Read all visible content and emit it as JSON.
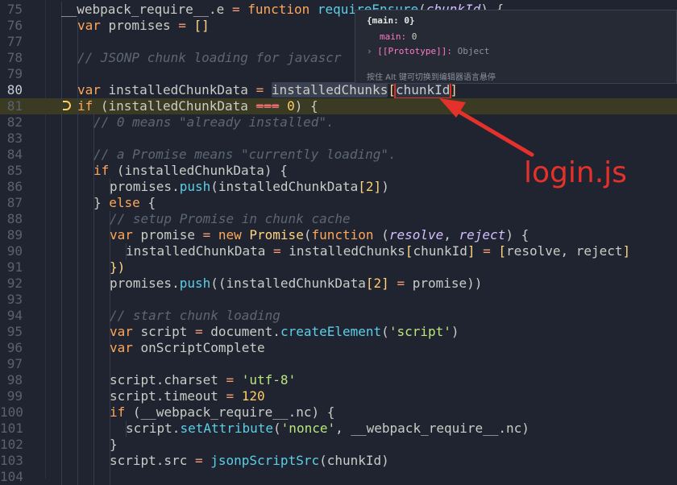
{
  "editor": {
    "lines": [
      {
        "n": "75",
        "indent": 1,
        "tokens": [
          [
            "__webpack_require__",
            "v"
          ],
          [
            ".e ",
            "v"
          ],
          [
            "= ",
            "p"
          ],
          [
            "function ",
            "k"
          ],
          [
            "requireEnsure",
            "f"
          ],
          [
            "(",
            "v"
          ],
          [
            "chunkId",
            "it"
          ],
          [
            ") {",
            "v"
          ]
        ]
      },
      {
        "n": "76",
        "indent": 2,
        "tokens": [
          [
            "var ",
            "k"
          ],
          [
            "promises ",
            "v"
          ],
          [
            "= ",
            "p"
          ],
          [
            "[]",
            "y"
          ]
        ]
      },
      {
        "n": "77",
        "indent": 2,
        "tokens": []
      },
      {
        "n": "78",
        "indent": 2,
        "tokens": [
          [
            "// JSONP chunk loading for javascr",
            "c"
          ]
        ]
      },
      {
        "n": "79",
        "indent": 2,
        "tokens": []
      },
      {
        "n": "80",
        "indent": 2,
        "current": true,
        "tokens": [
          [
            "var ",
            "k"
          ],
          [
            "installedChunkData ",
            "v"
          ],
          [
            "= ",
            "p"
          ],
          [
            "installedChunks",
            "hl"
          ],
          [
            "[",
            "y"
          ],
          [
            "chunkId",
            "box"
          ],
          [
            "]",
            "y"
          ]
        ]
      },
      {
        "n": "81",
        "indent": 2,
        "exec": true,
        "tokens": [
          [
            "if ",
            "k"
          ],
          [
            "(installedChunkData ",
            "v"
          ],
          [
            "===",
            "neq"
          ],
          [
            " 0",
            "n"
          ],
          [
            ") {",
            "v"
          ]
        ]
      },
      {
        "n": "82",
        "indent": 3,
        "tokens": [
          [
            "// 0 means \"already installed\".",
            "c"
          ]
        ]
      },
      {
        "n": "83",
        "indent": 3,
        "tokens": []
      },
      {
        "n": "84",
        "indent": 3,
        "tokens": [
          [
            "// a Promise means \"currently loading\".",
            "c"
          ]
        ]
      },
      {
        "n": "85",
        "indent": 3,
        "tokens": [
          [
            "if ",
            "k"
          ],
          [
            "(installedChunkData) {",
            "v"
          ]
        ]
      },
      {
        "n": "86",
        "indent": 4,
        "tokens": [
          [
            "promises",
            "v"
          ],
          [
            ".",
            "v"
          ],
          [
            "push",
            "f"
          ],
          [
            "(installedChunkData",
            "v"
          ],
          [
            "[",
            "y"
          ],
          [
            "2",
            "n"
          ],
          [
            "]",
            "y"
          ],
          [
            ")",
            "v"
          ]
        ]
      },
      {
        "n": "87",
        "indent": 3,
        "tokens": [
          [
            "} ",
            "v"
          ],
          [
            "else ",
            "k"
          ],
          [
            "{",
            "v"
          ]
        ]
      },
      {
        "n": "88",
        "indent": 4,
        "tokens": [
          [
            "// setup Promise in chunk cache",
            "c"
          ]
        ]
      },
      {
        "n": "89",
        "indent": 4,
        "tokens": [
          [
            "var ",
            "k"
          ],
          [
            "promise ",
            "v"
          ],
          [
            "= ",
            "p"
          ],
          [
            "new ",
            "k"
          ],
          [
            "Promise",
            "y"
          ],
          [
            "(",
            "v"
          ],
          [
            "function ",
            "k"
          ],
          [
            "(",
            "v"
          ],
          [
            "resolve",
            "it"
          ],
          [
            ", ",
            "v"
          ],
          [
            "reject",
            "it"
          ],
          [
            ") {",
            "v"
          ]
        ]
      },
      {
        "n": "90",
        "indent": 5,
        "tokens": [
          [
            "installedChunkData ",
            "v"
          ],
          [
            "= ",
            "p"
          ],
          [
            "installedChunks",
            "v"
          ],
          [
            "[",
            "y"
          ],
          [
            "chunkId",
            "v"
          ],
          [
            "] ",
            "y"
          ],
          [
            "= ",
            "p"
          ],
          [
            "[",
            "y"
          ],
          [
            "resolve, reject",
            "v"
          ],
          [
            "]",
            "y"
          ]
        ]
      },
      {
        "n": "91",
        "indent": 4,
        "tokens": [
          [
            "})",
            "y"
          ]
        ]
      },
      {
        "n": "92",
        "indent": 4,
        "tokens": [
          [
            "promises",
            "v"
          ],
          [
            ".",
            "v"
          ],
          [
            "push",
            "f"
          ],
          [
            "((installedChunkData",
            "v"
          ],
          [
            "[",
            "y"
          ],
          [
            "2",
            "n"
          ],
          [
            "] ",
            "y"
          ],
          [
            "= ",
            "p"
          ],
          [
            "promise))",
            "v"
          ]
        ]
      },
      {
        "n": "93",
        "indent": 4,
        "tokens": []
      },
      {
        "n": "94",
        "indent": 4,
        "tokens": [
          [
            "// start chunk loading",
            "c"
          ]
        ]
      },
      {
        "n": "95",
        "indent": 4,
        "tokens": [
          [
            "var ",
            "k"
          ],
          [
            "script ",
            "v"
          ],
          [
            "= ",
            "p"
          ],
          [
            "document",
            "v"
          ],
          [
            ".",
            "v"
          ],
          [
            "createElement",
            "f"
          ],
          [
            "(",
            "v"
          ],
          [
            "'script'",
            "s"
          ],
          [
            ")",
            "v"
          ]
        ]
      },
      {
        "n": "96",
        "indent": 4,
        "tokens": [
          [
            "var ",
            "k"
          ],
          [
            "onScriptComplete",
            "v"
          ]
        ]
      },
      {
        "n": "97",
        "indent": 4,
        "tokens": []
      },
      {
        "n": "98",
        "indent": 4,
        "tokens": [
          [
            "script",
            "v"
          ],
          [
            ".charset ",
            "v"
          ],
          [
            "= ",
            "p"
          ],
          [
            "'utf-8'",
            "s"
          ]
        ]
      },
      {
        "n": "99",
        "indent": 4,
        "tokens": [
          [
            "script",
            "v"
          ],
          [
            ".timeout ",
            "v"
          ],
          [
            "= ",
            "p"
          ],
          [
            "120",
            "n"
          ]
        ]
      },
      {
        "n": "100",
        "indent": 4,
        "tokens": [
          [
            "if ",
            "k"
          ],
          [
            "(__webpack_require__.nc) {",
            "v"
          ]
        ]
      },
      {
        "n": "101",
        "indent": 5,
        "tokens": [
          [
            "script",
            "v"
          ],
          [
            ".",
            "v"
          ],
          [
            "setAttribute",
            "f"
          ],
          [
            "(",
            "v"
          ],
          [
            "'nonce'",
            "s"
          ],
          [
            ", __webpack_require__.nc)",
            "v"
          ]
        ]
      },
      {
        "n": "102",
        "indent": 4,
        "tokens": [
          [
            "}",
            "v"
          ]
        ]
      },
      {
        "n": "103",
        "indent": 4,
        "tokens": [
          [
            "script",
            "v"
          ],
          [
            ".src ",
            "v"
          ],
          [
            "= ",
            "p"
          ],
          [
            "jsonpScriptSrc",
            "f"
          ],
          [
            "(chunkId)",
            "v"
          ]
        ]
      },
      {
        "n": "104",
        "indent": 4,
        "tokens": []
      }
    ]
  },
  "tooltip": {
    "title": "{main: 0}",
    "prop_key": "main:",
    "prop_val": " 0",
    "proto_key": "[[Prototype]]:",
    "proto_val": " Object",
    "hint": "按住 Alt 键可切换到编辑器语言悬停"
  },
  "annotation": {
    "text": "login.js",
    "color": "#e5312b"
  },
  "colors": {
    "background": "#1f2430",
    "execution_line": "#3b3a22",
    "annotation_red": "#e5312b"
  }
}
